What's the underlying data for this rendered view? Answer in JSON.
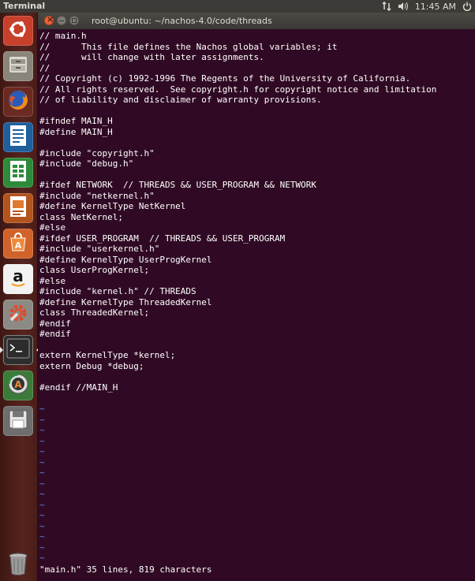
{
  "top_panel": {
    "app_title": "Terminal",
    "clock": "11:45 AM",
    "icons": [
      "network-icon",
      "volume-icon",
      "power-icon"
    ]
  },
  "launcher": {
    "items": [
      {
        "name": "ubuntu-dash-icon"
      },
      {
        "name": "files-icon"
      },
      {
        "name": "firefox-icon"
      },
      {
        "name": "writer-icon"
      },
      {
        "name": "calc-icon"
      },
      {
        "name": "impress-icon"
      },
      {
        "name": "software-center-icon"
      },
      {
        "name": "amazon-icon"
      },
      {
        "name": "system-settings-icon"
      },
      {
        "name": "terminal-icon",
        "active": true
      },
      {
        "name": "software-updater-icon"
      },
      {
        "name": "save-disk-icon"
      },
      {
        "name": "trash-icon"
      }
    ]
  },
  "window": {
    "title": "root@ubuntu: ~/nachos-4.0/code/threads"
  },
  "editor": {
    "lines": [
      "// main.h",
      "//      This file defines the Nachos global variables; it",
      "//      will change with later assignments.",
      "//",
      "// Copyright (c) 1992-1996 The Regents of the University of California.",
      "// All rights reserved.  See copyright.h for copyright notice and limitation",
      "// of liability and disclaimer of warranty provisions.",
      "",
      "#ifndef MAIN_H",
      "#define MAIN_H",
      "",
      "#include \"copyright.h\"",
      "#include \"debug.h\"",
      "",
      "#ifdef NETWORK  // THREADS && USER_PROGRAM && NETWORK",
      "#include \"netkernel.h\"",
      "#define KernelType NetKernel",
      "class NetKernel;",
      "#else",
      "#ifdef USER_PROGRAM  // THREADS && USER_PROGRAM",
      "#include \"userkernel.h\"",
      "#define KernelType UserProgKernel",
      "class UserProgKernel;",
      "#else",
      "#include \"kernel.h\" // THREADS",
      "#define KernelType ThreadedKernel",
      "class ThreadedKernel;",
      "#endif",
      "#endif",
      "",
      "extern KernelType *kernel;",
      "extern Debug *debug;",
      "",
      "#endif //MAIN_H"
    ],
    "empty_line_marker": "~",
    "empty_line_count": 15,
    "status_line": "\"main.h\" 35 lines, 819 characters",
    "colors": {
      "background": "#300a24",
      "text": "#ffffff",
      "tilde": "#5a84d8"
    }
  }
}
